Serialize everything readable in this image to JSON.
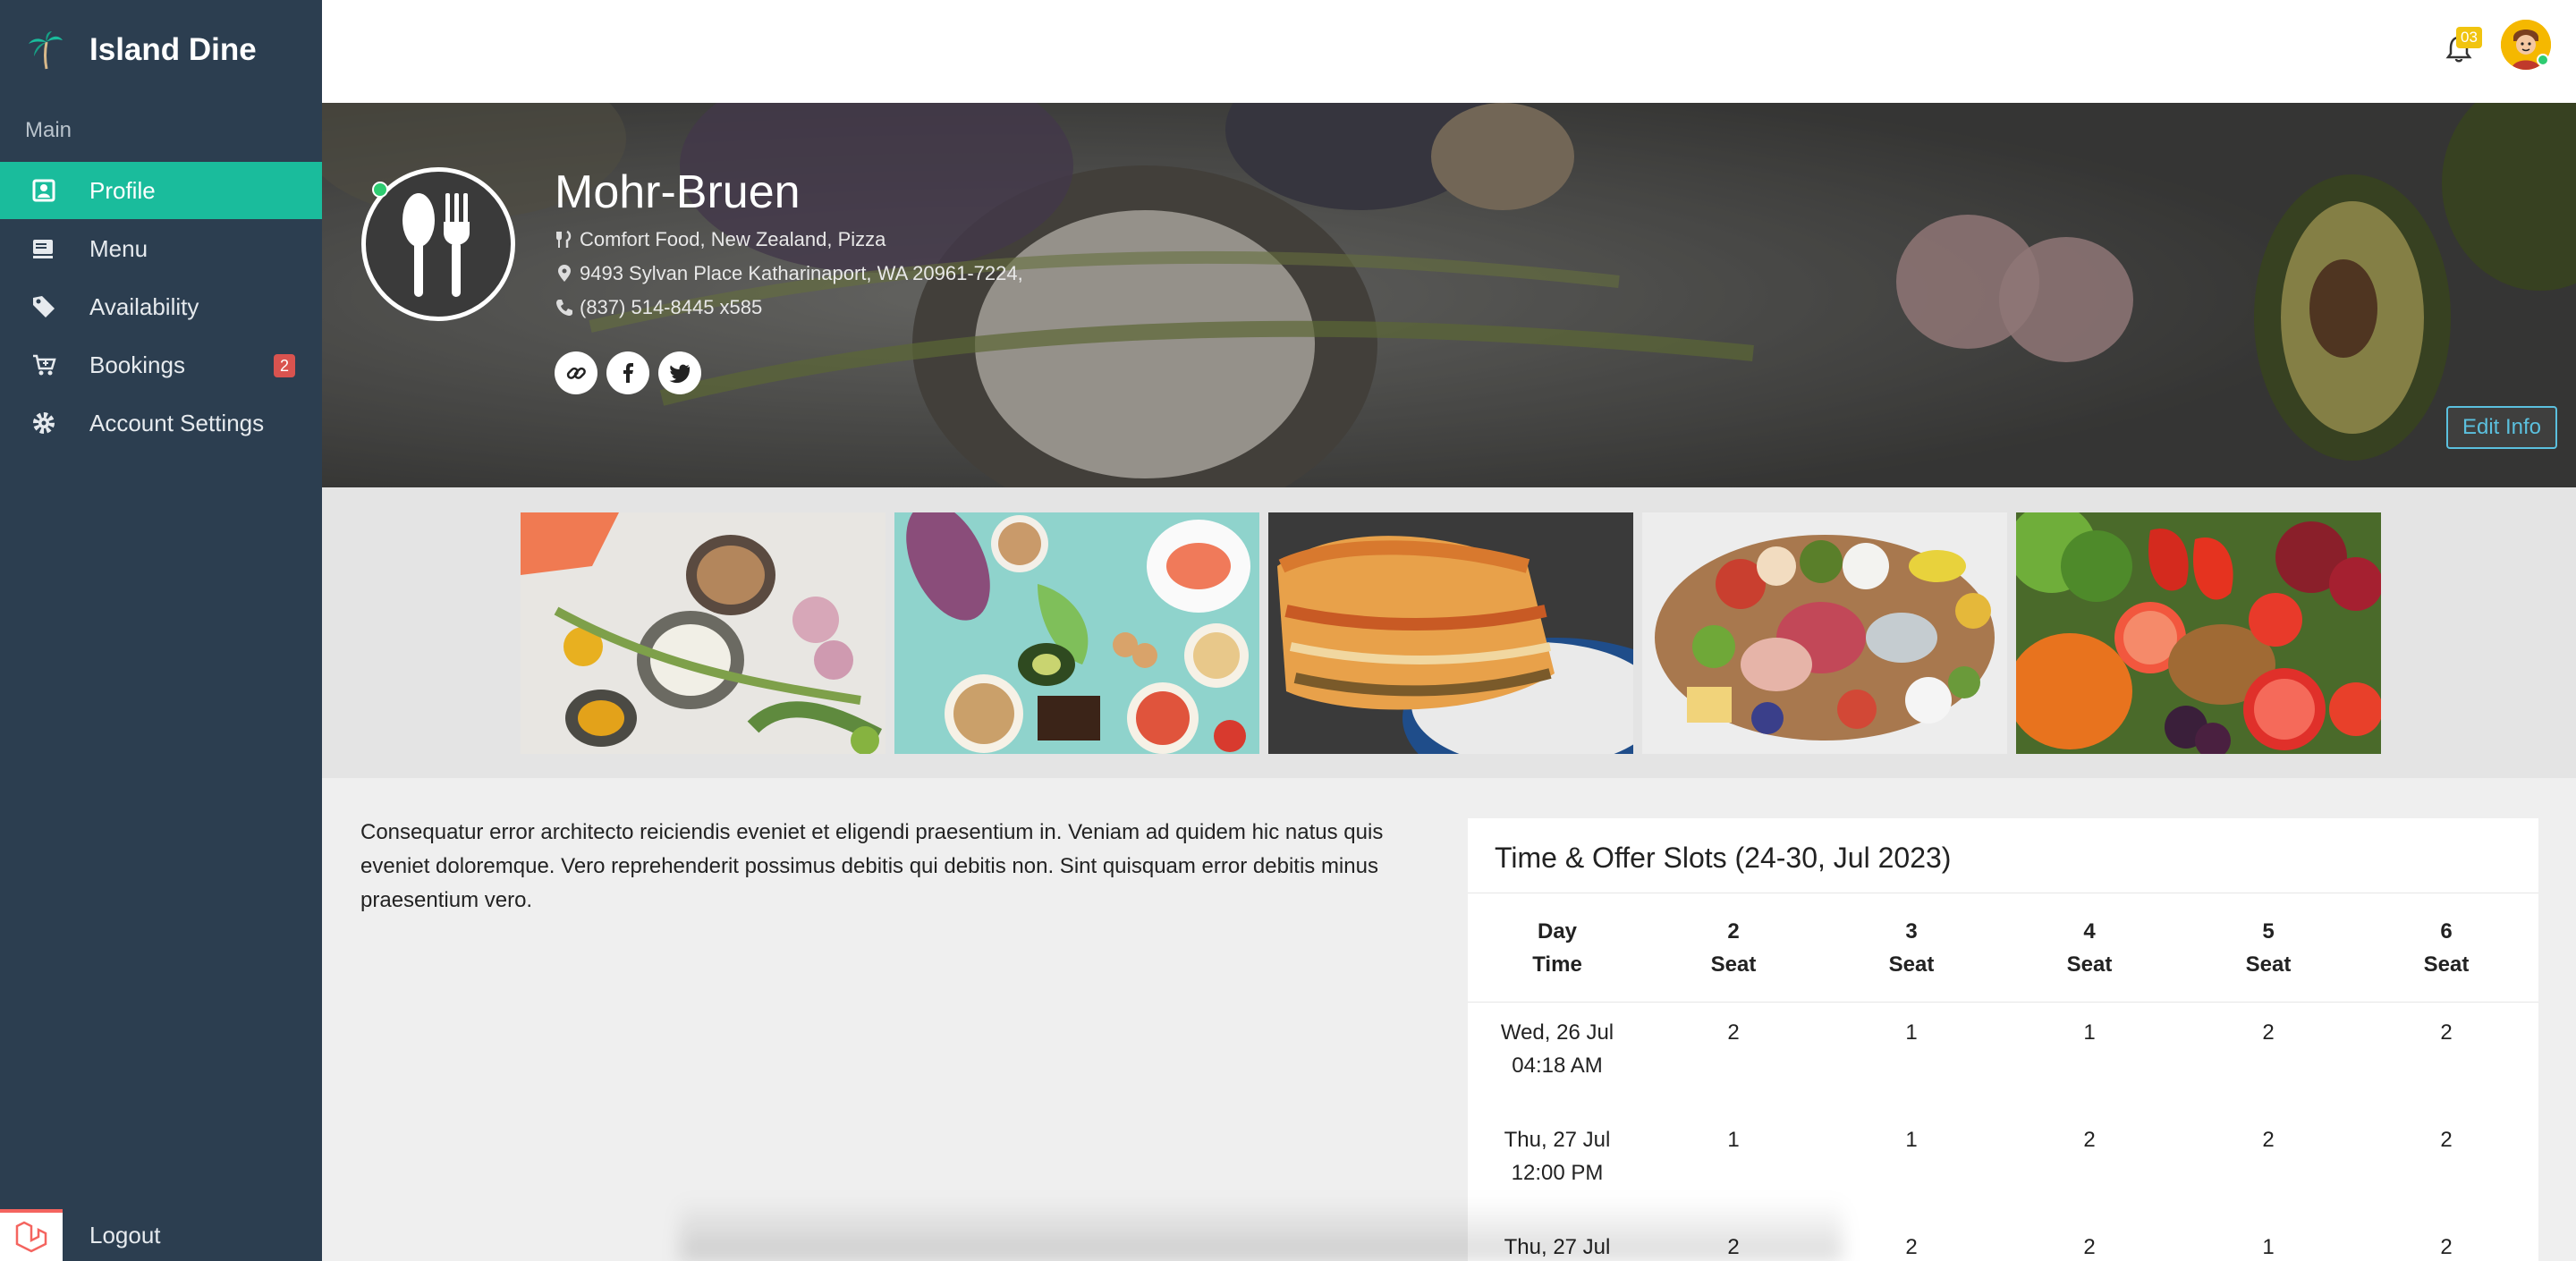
{
  "app": {
    "name": "Island Dine"
  },
  "sidebar": {
    "section_label": "Main",
    "items": [
      {
        "label": "Profile",
        "icon": "profile-icon",
        "active": true
      },
      {
        "label": "Menu",
        "icon": "menu-icon"
      },
      {
        "label": "Availability",
        "icon": "tag-icon"
      },
      {
        "label": "Bookings",
        "icon": "cart-icon",
        "badge": "2"
      },
      {
        "label": "Account Settings",
        "icon": "gear-icon"
      }
    ],
    "logout_label": "Logout"
  },
  "topbar": {
    "notification_count": "03"
  },
  "restaurant": {
    "name": "Mohr-Bruen",
    "cuisine": "Comfort Food, New Zealand, Pizza",
    "address": "9493 Sylvan Place Katharinaport, WA 20961-7224,",
    "phone": "(837) 514-8445 x585",
    "edit_label": "Edit Info",
    "description": "Consequatur error architecto reiciendis eveniet et eligendi praesentium in. Veniam ad quidem hic natus quis eveniet doloremque. Vero reprehenderit possimus debitis qui debitis non. Sint quisquam error debitis minus praesentium vero."
  },
  "slots": {
    "title": "Time & Offer Slots (24-30, Jul 2023)",
    "headers": [
      {
        "top": "Day",
        "bottom": "Time"
      },
      {
        "top": "2",
        "bottom": "Seat"
      },
      {
        "top": "3",
        "bottom": "Seat"
      },
      {
        "top": "4",
        "bottom": "Seat"
      },
      {
        "top": "5",
        "bottom": "Seat"
      },
      {
        "top": "6",
        "bottom": "Seat"
      }
    ],
    "rows": [
      {
        "day": "Wed, 26 Jul",
        "time": "04:18 AM",
        "values": [
          "2",
          "1",
          "1",
          "2",
          "2"
        ]
      },
      {
        "day": "Thu, 27 Jul",
        "time": "12:00 PM",
        "values": [
          "1",
          "1",
          "2",
          "2",
          "2"
        ]
      },
      {
        "day": "Thu, 27 Jul",
        "time": "",
        "values": [
          "2",
          "2",
          "2",
          "1",
          "2"
        ]
      }
    ]
  },
  "colors": {
    "sidebar": "#2c3e50",
    "accent": "#1abc9c",
    "badge": "#d9534f",
    "notify": "#f1c40f",
    "edit": "#5bc0de"
  }
}
